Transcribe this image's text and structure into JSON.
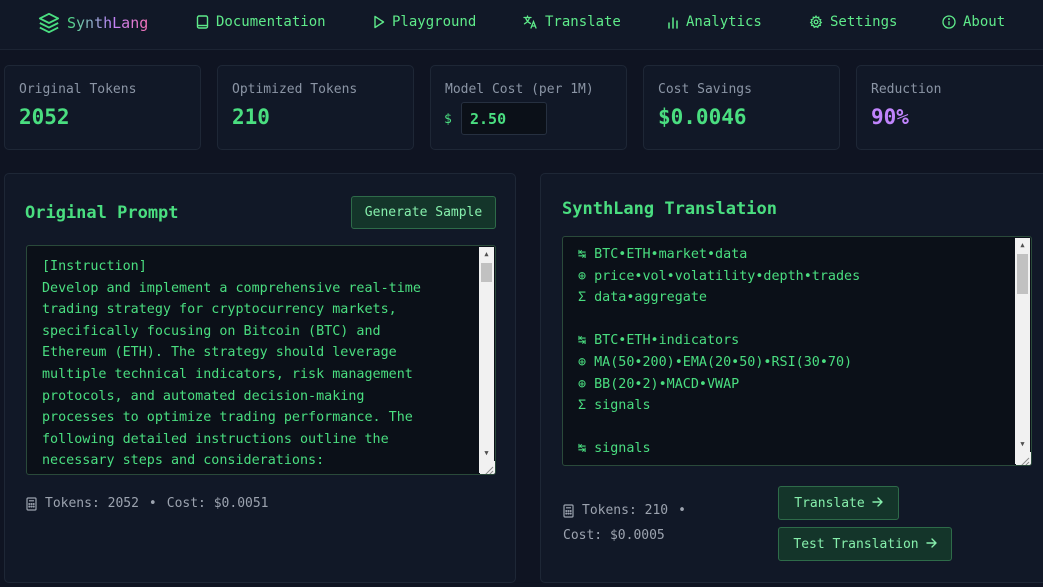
{
  "nav": {
    "brand": "SynthLang",
    "items": [
      {
        "label": "Documentation",
        "icon": "book-icon"
      },
      {
        "label": "Playground",
        "icon": "play-icon"
      },
      {
        "label": "Translate",
        "icon": "translate-icon"
      },
      {
        "label": "Analytics",
        "icon": "bar-chart-icon"
      },
      {
        "label": "Settings",
        "icon": "gear-icon"
      },
      {
        "label": "About",
        "icon": "info-icon"
      }
    ]
  },
  "stats": {
    "original_tokens": {
      "label": "Original Tokens",
      "value": "2052"
    },
    "optimized_tokens": {
      "label": "Optimized Tokens",
      "value": "210"
    },
    "model_cost": {
      "label": "Model Cost (per 1M)",
      "currency": "$",
      "value": "2.50"
    },
    "cost_savings": {
      "label": "Cost Savings",
      "value": "$0.0046"
    },
    "reduction": {
      "label": "Reduction",
      "value": "90%"
    }
  },
  "original": {
    "title": "Original Prompt",
    "generate_button": "Generate Sample",
    "text": "[Instruction]\nDevelop and implement a comprehensive real-time\ntrading strategy for cryptocurrency markets,\nspecifically focusing on Bitcoin (BTC) and\nEthereum (ETH). The strategy should leverage\nmultiple technical indicators, risk management\nprotocols, and automated decision-making\nprocesses to optimize trading performance. The\nfollowing detailed instructions outline the\nnecessary steps and considerations:",
    "tokens_label": "Tokens: 2052",
    "separator": "•",
    "cost_label": "Cost: $0.0051"
  },
  "translation": {
    "title": "SynthLang Translation",
    "text": "↹ BTC•ETH•market•data\n⊕ price•vol•volatility•depth•trades\nΣ data•aggregate\n\n↹ BTC•ETH•indicators\n⊕ MA(50•200)•EMA(20•50)•RSI(30•70)\n⊕ BB(20•2)•MACD•VWAP\nΣ signals\n\n↹ signals",
    "tokens_label": "Tokens: 210",
    "separator": "•",
    "cost_label": "Cost: $0.0005",
    "translate_button": "Translate",
    "test_button": "Test Translation"
  },
  "colors": {
    "background": "#0f1422",
    "accent_green": "#4ade80",
    "accent_purple": "#c084fc",
    "button_bg": "#14352a"
  }
}
